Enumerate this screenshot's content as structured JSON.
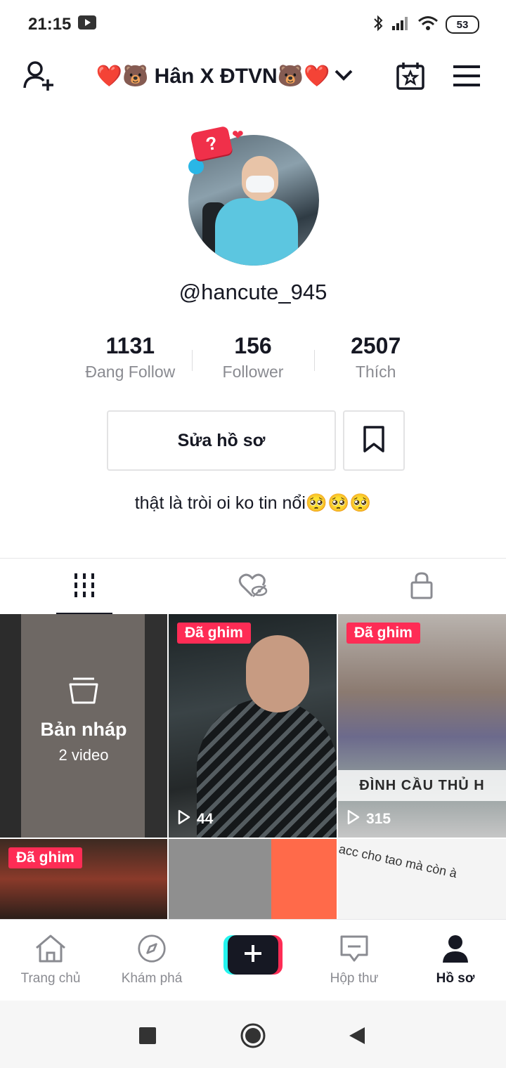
{
  "status_bar": {
    "time": "21:15",
    "battery": "53",
    "icons": [
      "youtube-icon",
      "bluetooth-icon",
      "signal-icon",
      "wifi-icon",
      "battery-icon"
    ]
  },
  "header": {
    "title": "❤️🐻 Hân X ĐTVN🐻❤️",
    "icons": [
      "add-friend-icon",
      "chevron-down-icon",
      "calendar-star-icon",
      "menu-icon"
    ]
  },
  "profile": {
    "username": "@hancute_945",
    "stats": [
      {
        "value": "1131",
        "label": "Đang Follow"
      },
      {
        "value": "156",
        "label": "Follower"
      },
      {
        "value": "2507",
        "label": "Thích"
      }
    ],
    "edit_button": "Sửa hồ sơ",
    "bio": "thật là tròi oi ko tin nổi🥺🥺🥺"
  },
  "tabs": {
    "items": [
      "videos-grid-icon",
      "liked-hidden-icon",
      "private-lock-icon"
    ],
    "active_index": 0
  },
  "grid": {
    "draft": {
      "title": "Bản nháp",
      "count": "2 video"
    },
    "items": [
      {
        "pinned_label": "Đã ghim",
        "plays": "44"
      },
      {
        "pinned_label": "Đã ghim",
        "plays": "315",
        "caption": "ĐÌNH CẦU THỦ H"
      },
      {
        "pinned_label": "Đã ghim"
      },
      {},
      {
        "caption": "acc cho tao mà còn à"
      }
    ]
  },
  "bottom_nav": {
    "items": [
      {
        "label": "Trang chủ",
        "icon": "home-icon"
      },
      {
        "label": "Khám phá",
        "icon": "compass-icon"
      },
      {
        "label": "",
        "icon": "plus-icon"
      },
      {
        "label": "Hộp thư",
        "icon": "inbox-icon"
      },
      {
        "label": "Hồ sơ",
        "icon": "profile-icon"
      }
    ],
    "active_index": 4
  },
  "colors": {
    "accent": "#fe2c55",
    "accent_cyan": "#25f4ee",
    "text": "#161823",
    "muted": "#8a8b91"
  }
}
